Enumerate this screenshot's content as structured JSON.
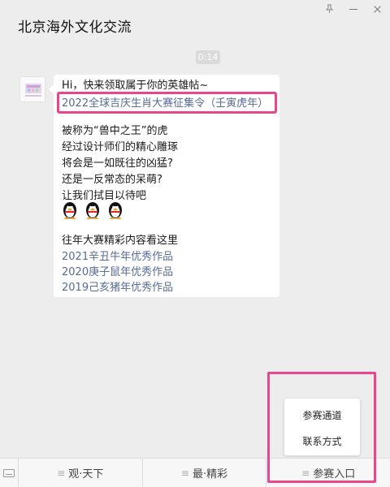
{
  "header": {
    "title": "北京海外文化交流"
  },
  "chat": {
    "time": "0:14",
    "message": {
      "greeting": "Hi，快来领取属于你的英雄帖~",
      "headline_link": "2022全球吉庆生肖大赛征集令（壬寅虎年）",
      "body": [
        "被称为“兽中之王”的虎",
        "经过设计师们的精心雕琢",
        "将会是一如既往的凶猛?",
        "还是一反常态的呆萌?",
        "让我们拭目以待吧"
      ],
      "emoji_count": 3,
      "past_intro": "往年大赛精彩内容看这里",
      "past_links": [
        "2021辛丑牛年优秀作品",
        "2020庚子鼠年优秀作品",
        "2019己亥猪年优秀作品"
      ]
    }
  },
  "menu": {
    "items": [
      {
        "label": "观·天下"
      },
      {
        "label": "最·精彩"
      },
      {
        "label": "参赛入口"
      }
    ],
    "submenu": [
      "参赛通道",
      "联系方式"
    ]
  },
  "colors": {
    "highlight": "#e8478b",
    "link": "#576b95",
    "background": "#ededed"
  },
  "icons": [
    "pin-icon",
    "minimize-icon",
    "close-icon",
    "keyboard-icon",
    "menu-lines-icon",
    "penguin-emoji"
  ]
}
